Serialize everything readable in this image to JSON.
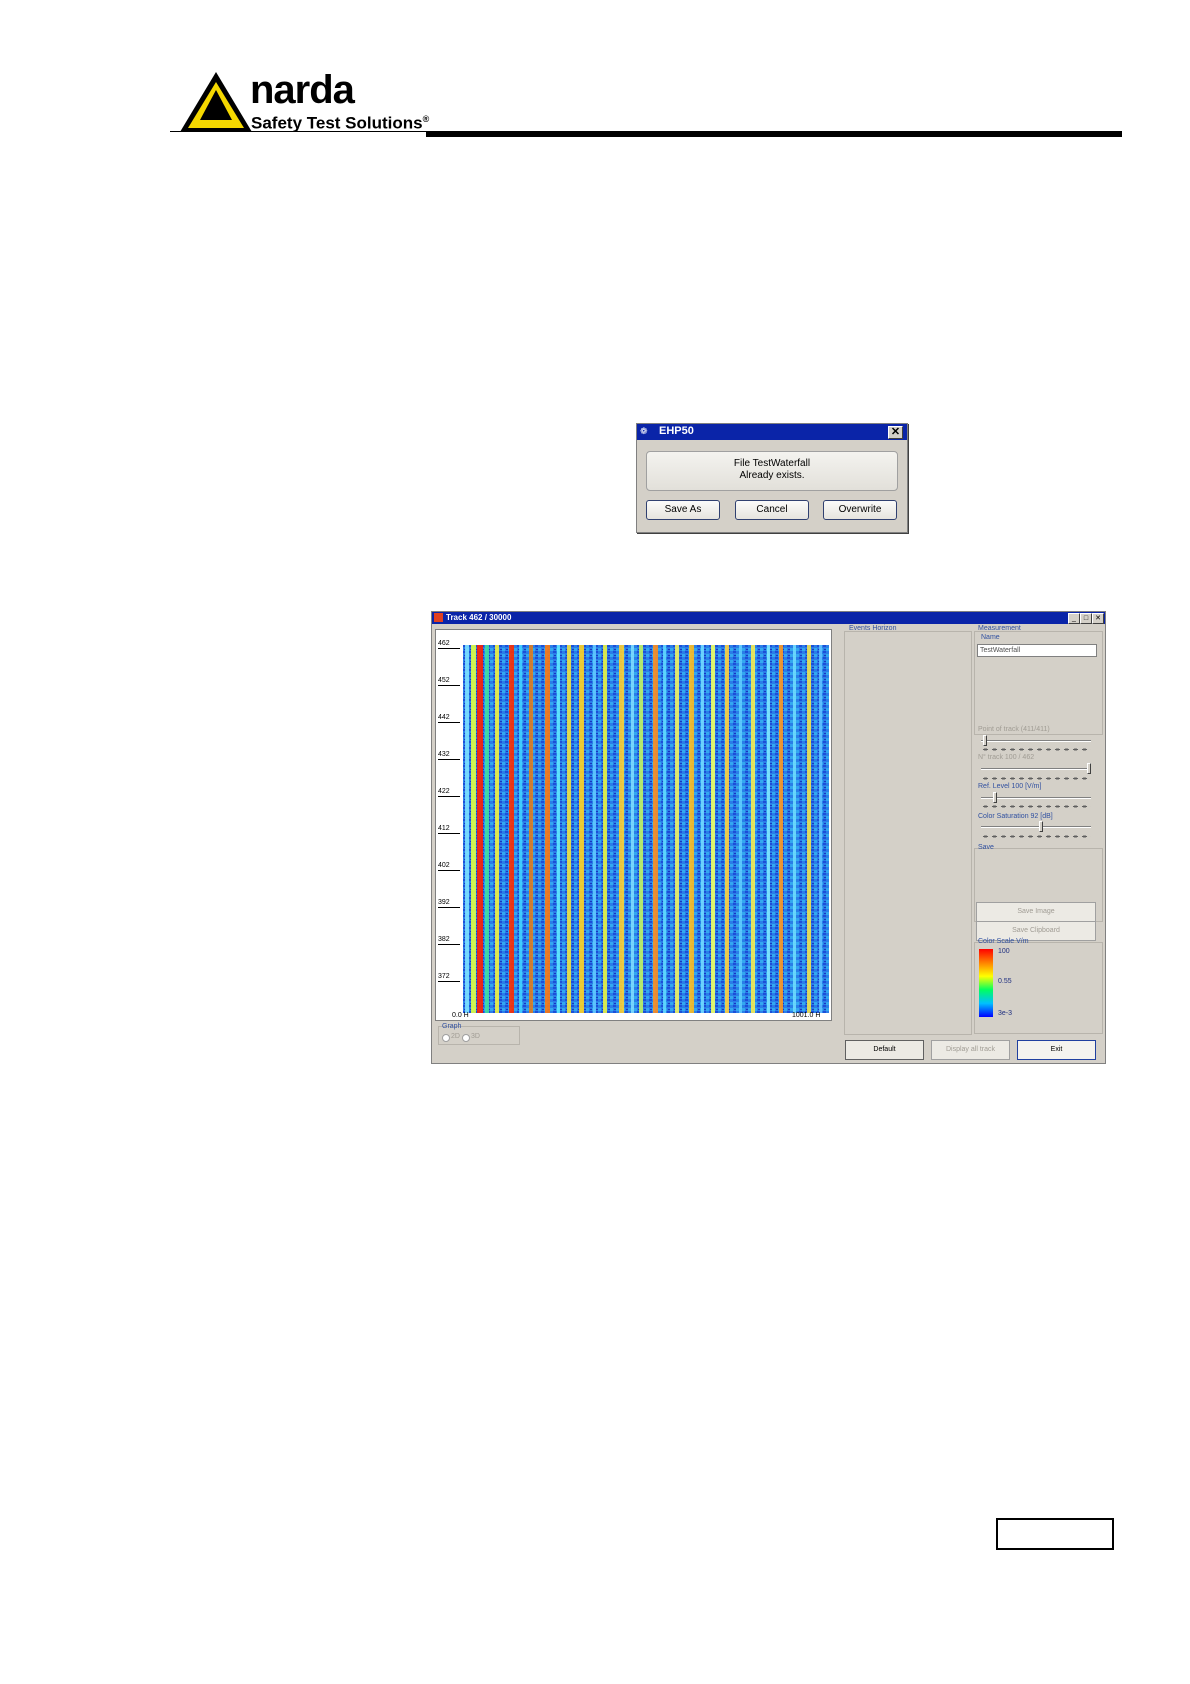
{
  "header": {
    "brand_name": "narda",
    "brand_tagline": "Safety Test Solutions",
    "registered_mark": "®"
  },
  "dialog": {
    "title": "EHP50",
    "close_glyph": "✕",
    "message_line1": "File TestWaterfall",
    "message_line2": "Already exists.",
    "buttons": [
      "Save As",
      "Cancel",
      "Overwrite"
    ]
  },
  "app": {
    "title": "Track 462 / 30000",
    "y_ticks": [
      "462",
      "452",
      "442",
      "432",
      "422",
      "412",
      "402",
      "392",
      "382",
      "372"
    ],
    "x_start": "0.0 H",
    "x_end": "1001.0 H",
    "events_horizon_label": "Events Horizon",
    "measurement_label": "Measurement",
    "name_label": "Name",
    "name_value": "TestWaterfall",
    "point_of_track_label": "Point of track (411/411)",
    "n_track_label": "N° track 100 / 462",
    "ref_level_label": "Ref. Level 100 [V/m]",
    "color_saturation_label": "Color Saturation 92 [dB]",
    "save_label": "Save",
    "save_image_button": "Save Image",
    "save_clipboard_button": "Save Clipboard",
    "color_scale_label": "Color Scale V/m",
    "color_scale_max": "100",
    "color_scale_mid": "0.55",
    "color_scale_min": "3e-3",
    "graph_label": "Graph",
    "graph_options": [
      "2D",
      "3D"
    ],
    "default_button": "Default",
    "display_all_button": "Display all track",
    "exit_button": "Exit",
    "colors": {
      "title_bar": "#0a24a8",
      "window_face": "#d4d0c8",
      "group_label": "#3050a0"
    }
  }
}
